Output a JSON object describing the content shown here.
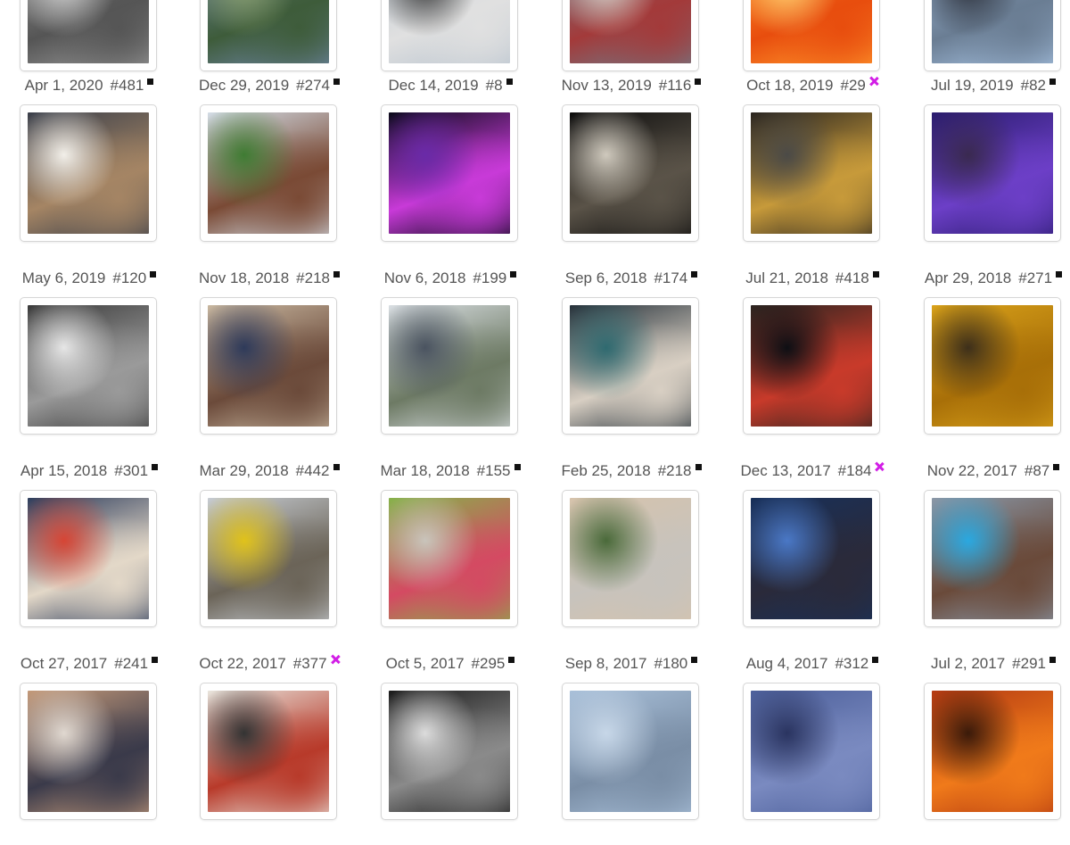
{
  "rows": [
    [
      {
        "date": "",
        "num": "",
        "mark": "none",
        "colors": [
          "#9a9a9a",
          "#555",
          "#cfcfcf"
        ]
      },
      {
        "date": "",
        "num": "",
        "mark": "none",
        "colors": [
          "#6f86a8",
          "#3e5c3a",
          "#8aa070"
        ]
      },
      {
        "date": "",
        "num": "",
        "mark": "none",
        "colors": [
          "#b9c4cf",
          "#e0e0e0",
          "#3b3b3b"
        ]
      },
      {
        "date": "",
        "num": "",
        "mark": "none",
        "colors": [
          "#6e7c89",
          "#a33a3a",
          "#d7d0c8"
        ]
      },
      {
        "date": "",
        "num": "",
        "mark": "none",
        "colors": [
          "#ff9b2e",
          "#e84d0e",
          "#ffcf70"
        ]
      },
      {
        "date": "",
        "num": "",
        "mark": "none",
        "colors": [
          "#a8c4e4",
          "#6a7d93",
          "#2b2f39"
        ]
      }
    ],
    [
      {
        "date": "Apr 1, 2020",
        "num": "#481",
        "mark": "square",
        "colors": [
          "#3a3f4a",
          "#a58564",
          "#f2efe9"
        ]
      },
      {
        "date": "Dec 29, 2019",
        "num": "#274",
        "mark": "square",
        "colors": [
          "#d3dce5",
          "#7a4a35",
          "#3f7c33"
        ]
      },
      {
        "date": "Dec 14, 2019",
        "num": "#8",
        "mark": "square",
        "colors": [
          "#0a0a1a",
          "#c83ad8",
          "#6a2aa8"
        ]
      },
      {
        "date": "Nov 13, 2019",
        "num": "#116",
        "mark": "square",
        "colors": [
          "#0c0c0c",
          "#5a5348",
          "#cfc9bd"
        ]
      },
      {
        "date": "Oct 18, 2019",
        "num": "#29",
        "mark": "x",
        "colors": [
          "#2a2520",
          "#c79a3a",
          "#4b4a47"
        ]
      },
      {
        "date": "Jul 19, 2019",
        "num": "#82",
        "mark": "square",
        "colors": [
          "#2a1c6e",
          "#6c3fc7",
          "#3a2a50"
        ]
      }
    ],
    [
      {
        "date": "May 6, 2019",
        "num": "#120",
        "mark": "square",
        "colors": [
          "#3a3a3a",
          "#9a9a9a",
          "#e6e6e6"
        ]
      },
      {
        "date": "Nov 18, 2018",
        "num": "#218",
        "mark": "square",
        "colors": [
          "#c8b7a0",
          "#6b4a3a",
          "#2e3a5a"
        ]
      },
      {
        "date": "Nov 6, 2018",
        "num": "#199",
        "mark": "square",
        "colors": [
          "#d9dee2",
          "#6d7a64",
          "#4a5360"
        ]
      },
      {
        "date": "Sep 6, 2018",
        "num": "#174",
        "mark": "square",
        "colors": [
          "#26313a",
          "#d8cfc3",
          "#2f6a70"
        ]
      },
      {
        "date": "Jul 21, 2018",
        "num": "#418",
        "mark": "square",
        "colors": [
          "#2a2420",
          "#c83a2a",
          "#0e0f14"
        ]
      },
      {
        "date": "Apr 29, 2018",
        "num": "#271",
        "mark": "square",
        "colors": [
          "#d9a21a",
          "#a86f08",
          "#3d2f1a"
        ]
      }
    ],
    [
      {
        "date": "Apr 15, 2018",
        "num": "#301",
        "mark": "square",
        "colors": [
          "#2e3d5c",
          "#e3d8c8",
          "#d64535"
        ]
      },
      {
        "date": "Mar 29, 2018",
        "num": "#442",
        "mark": "square",
        "colors": [
          "#c7ccd2",
          "#6b6458",
          "#e0c21a"
        ]
      },
      {
        "date": "Mar 18, 2018",
        "num": "#155",
        "mark": "square",
        "colors": [
          "#86b24a",
          "#d44a62",
          "#c9c4bb"
        ]
      },
      {
        "date": "Feb 25, 2018",
        "num": "#218",
        "mark": "square",
        "colors": [
          "#d6c3ac",
          "#c7c3bd",
          "#4a6a3a"
        ]
      },
      {
        "date": "Dec 13, 2017",
        "num": "#184",
        "mark": "x",
        "colors": [
          "#18305a",
          "#2a2a3a",
          "#4a78c6"
        ]
      },
      {
        "date": "Nov 22, 2017",
        "num": "#87",
        "mark": "square",
        "colors": [
          "#8a98a8",
          "#6a4a3a",
          "#2aa8e0"
        ]
      }
    ],
    [
      {
        "date": "Oct 27, 2017",
        "num": "#241",
        "mark": "square",
        "colors": [
          "#c49a7a",
          "#3a3a4a",
          "#e0d8d0"
        ]
      },
      {
        "date": "Oct 22, 2017",
        "num": "#377",
        "mark": "x",
        "colors": [
          "#e8e4dc",
          "#b83a2a",
          "#333"
        ]
      },
      {
        "date": "Oct 5, 2017",
        "num": "#295",
        "mark": "square",
        "colors": [
          "#1a1a1a",
          "#8a8a8a",
          "#dcdcdc"
        ]
      },
      {
        "date": "Sep 8, 2017",
        "num": "#180",
        "mark": "square",
        "colors": [
          "#a9c0d9",
          "#7a8ea6",
          "#c7d7e8"
        ]
      },
      {
        "date": "Aug 4, 2017",
        "num": "#312",
        "mark": "square",
        "colors": [
          "#4c5f9a",
          "#7a8ac0",
          "#2a3460"
        ]
      },
      {
        "date": "Jul 2, 2017",
        "num": "#291",
        "mark": "square",
        "colors": [
          "#b33a12",
          "#f07a1a",
          "#3a1a0a"
        ]
      }
    ]
  ]
}
